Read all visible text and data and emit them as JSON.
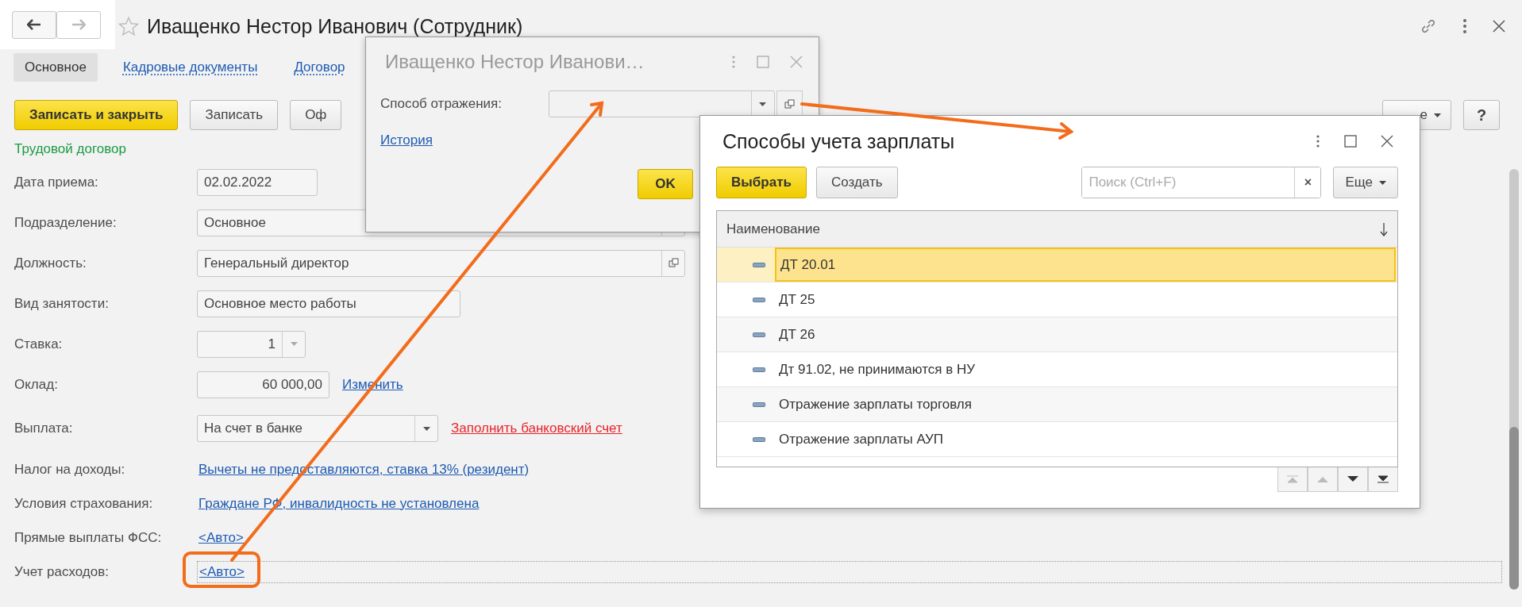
{
  "window": {
    "title": "Иващенко Нестор Иванович (Сотрудник)"
  },
  "tabs": [
    {
      "label": "Основное",
      "selected": true
    },
    {
      "label": "Кадровые документы",
      "selected": false
    },
    {
      "label": "Договор",
      "selected": false
    }
  ],
  "toolbar": {
    "buttons": [
      {
        "label": "Записать и закрыть",
        "kind": "primary"
      },
      {
        "label": "Записать",
        "kind": "default"
      },
      {
        "label": "Оф",
        "kind": "default"
      }
    ],
    "more": "е",
    "help": "?"
  },
  "section": "Трудовой договор",
  "fields": [
    {
      "label": "Дата приема:",
      "kind": "date",
      "value": "02.02.2022"
    },
    {
      "label": "Подразделение:",
      "kind": "choice",
      "value": "Основное"
    },
    {
      "label": "Должность:",
      "kind": "ref",
      "value": "Генеральный директор"
    },
    {
      "label": "Вид занятости:",
      "kind": "text",
      "value": "Основное место работы"
    },
    {
      "label": "Ставка:",
      "kind": "spin",
      "value": "1"
    },
    {
      "label": "Оклад:",
      "kind": "money",
      "value": "60 000,00",
      "link": "Изменить"
    },
    {
      "label": "Выплата:",
      "kind": "select",
      "value": "На счет в банке",
      "link": "Заполнить банковский счет",
      "warning": true
    },
    {
      "label": "Налог на доходы:",
      "kind": "link",
      "value": "Вычеты не предоставляются, ставка 13% (резидент)"
    },
    {
      "label": "Условия страхования:",
      "kind": "link",
      "value": "Граждане РФ, инвалидность не установлена"
    },
    {
      "label": "Прямые выплаты ФСС:",
      "kind": "link",
      "value": "<Авто>"
    },
    {
      "label": "Учет расходов:",
      "kind": "linkfield",
      "value": "<Авто>",
      "highlighted": true
    }
  ],
  "dialog": {
    "title": "Иващенко Нестор Иванови…",
    "field_label": "Способ отражения:",
    "link": "История",
    "ok": "OK"
  },
  "picker": {
    "title": "Способы учета зарплаты",
    "select": "Выбрать",
    "create": "Создать",
    "search": {
      "placeholder": "Поиск (Ctrl+F)"
    },
    "clear": "×",
    "more": "Еще",
    "column": "Наименование",
    "rows": [
      {
        "name": "ДТ 20.01",
        "selected": true
      },
      {
        "name": "ДТ 25",
        "selected": false
      },
      {
        "name": "ДТ 26",
        "selected": false
      },
      {
        "name": "Дт 91.02, не принимаются в НУ",
        "selected": false
      },
      {
        "name": "Отражение зарплаты торговля",
        "selected": false
      },
      {
        "name": "Отражение зарплаты АУП",
        "selected": false
      }
    ]
  }
}
